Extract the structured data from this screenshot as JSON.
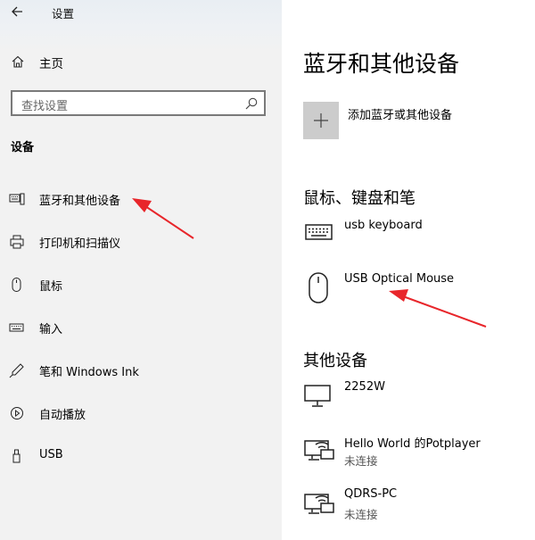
{
  "window": {
    "title": "设置"
  },
  "sidebar": {
    "home_label": "主页",
    "search_placeholder": "查找设置",
    "section_label": "设备",
    "items": [
      {
        "label": "蓝牙和其他设备",
        "icon": "bluetooth-devices-icon"
      },
      {
        "label": "打印机和扫描仪",
        "icon": "printer-icon"
      },
      {
        "label": "鼠标",
        "icon": "mouse-icon"
      },
      {
        "label": "输入",
        "icon": "keyboard-icon"
      },
      {
        "label": "笔和 Windows Ink",
        "icon": "pen-icon"
      },
      {
        "label": "自动播放",
        "icon": "autoplay-icon"
      },
      {
        "label": "USB",
        "icon": "usb-icon"
      }
    ]
  },
  "main": {
    "title": "蓝牙和其他设备",
    "add_label": "添加蓝牙或其他设备",
    "sections": [
      {
        "heading": "鼠标、键盘和笔",
        "devices": [
          {
            "name": "usb keyboard",
            "status": "",
            "icon": "keyboard-icon"
          },
          {
            "name": "USB Optical Mouse",
            "status": "",
            "icon": "mouse-icon"
          }
        ]
      },
      {
        "heading": "其他设备",
        "devices": [
          {
            "name": "2252W",
            "status": "",
            "icon": "monitor-icon"
          },
          {
            "name": "Hello World 的Potplayer",
            "status": "未连接",
            "icon": "media-device-icon"
          },
          {
            "name": "QDRS-PC",
            "status": "未连接",
            "icon": "media-device-icon"
          }
        ]
      }
    ]
  },
  "colors": {
    "annotation_arrow": "#e8262b",
    "add_button_bg": "#cccccc",
    "sidebar_bg": "#f2f2f2"
  }
}
